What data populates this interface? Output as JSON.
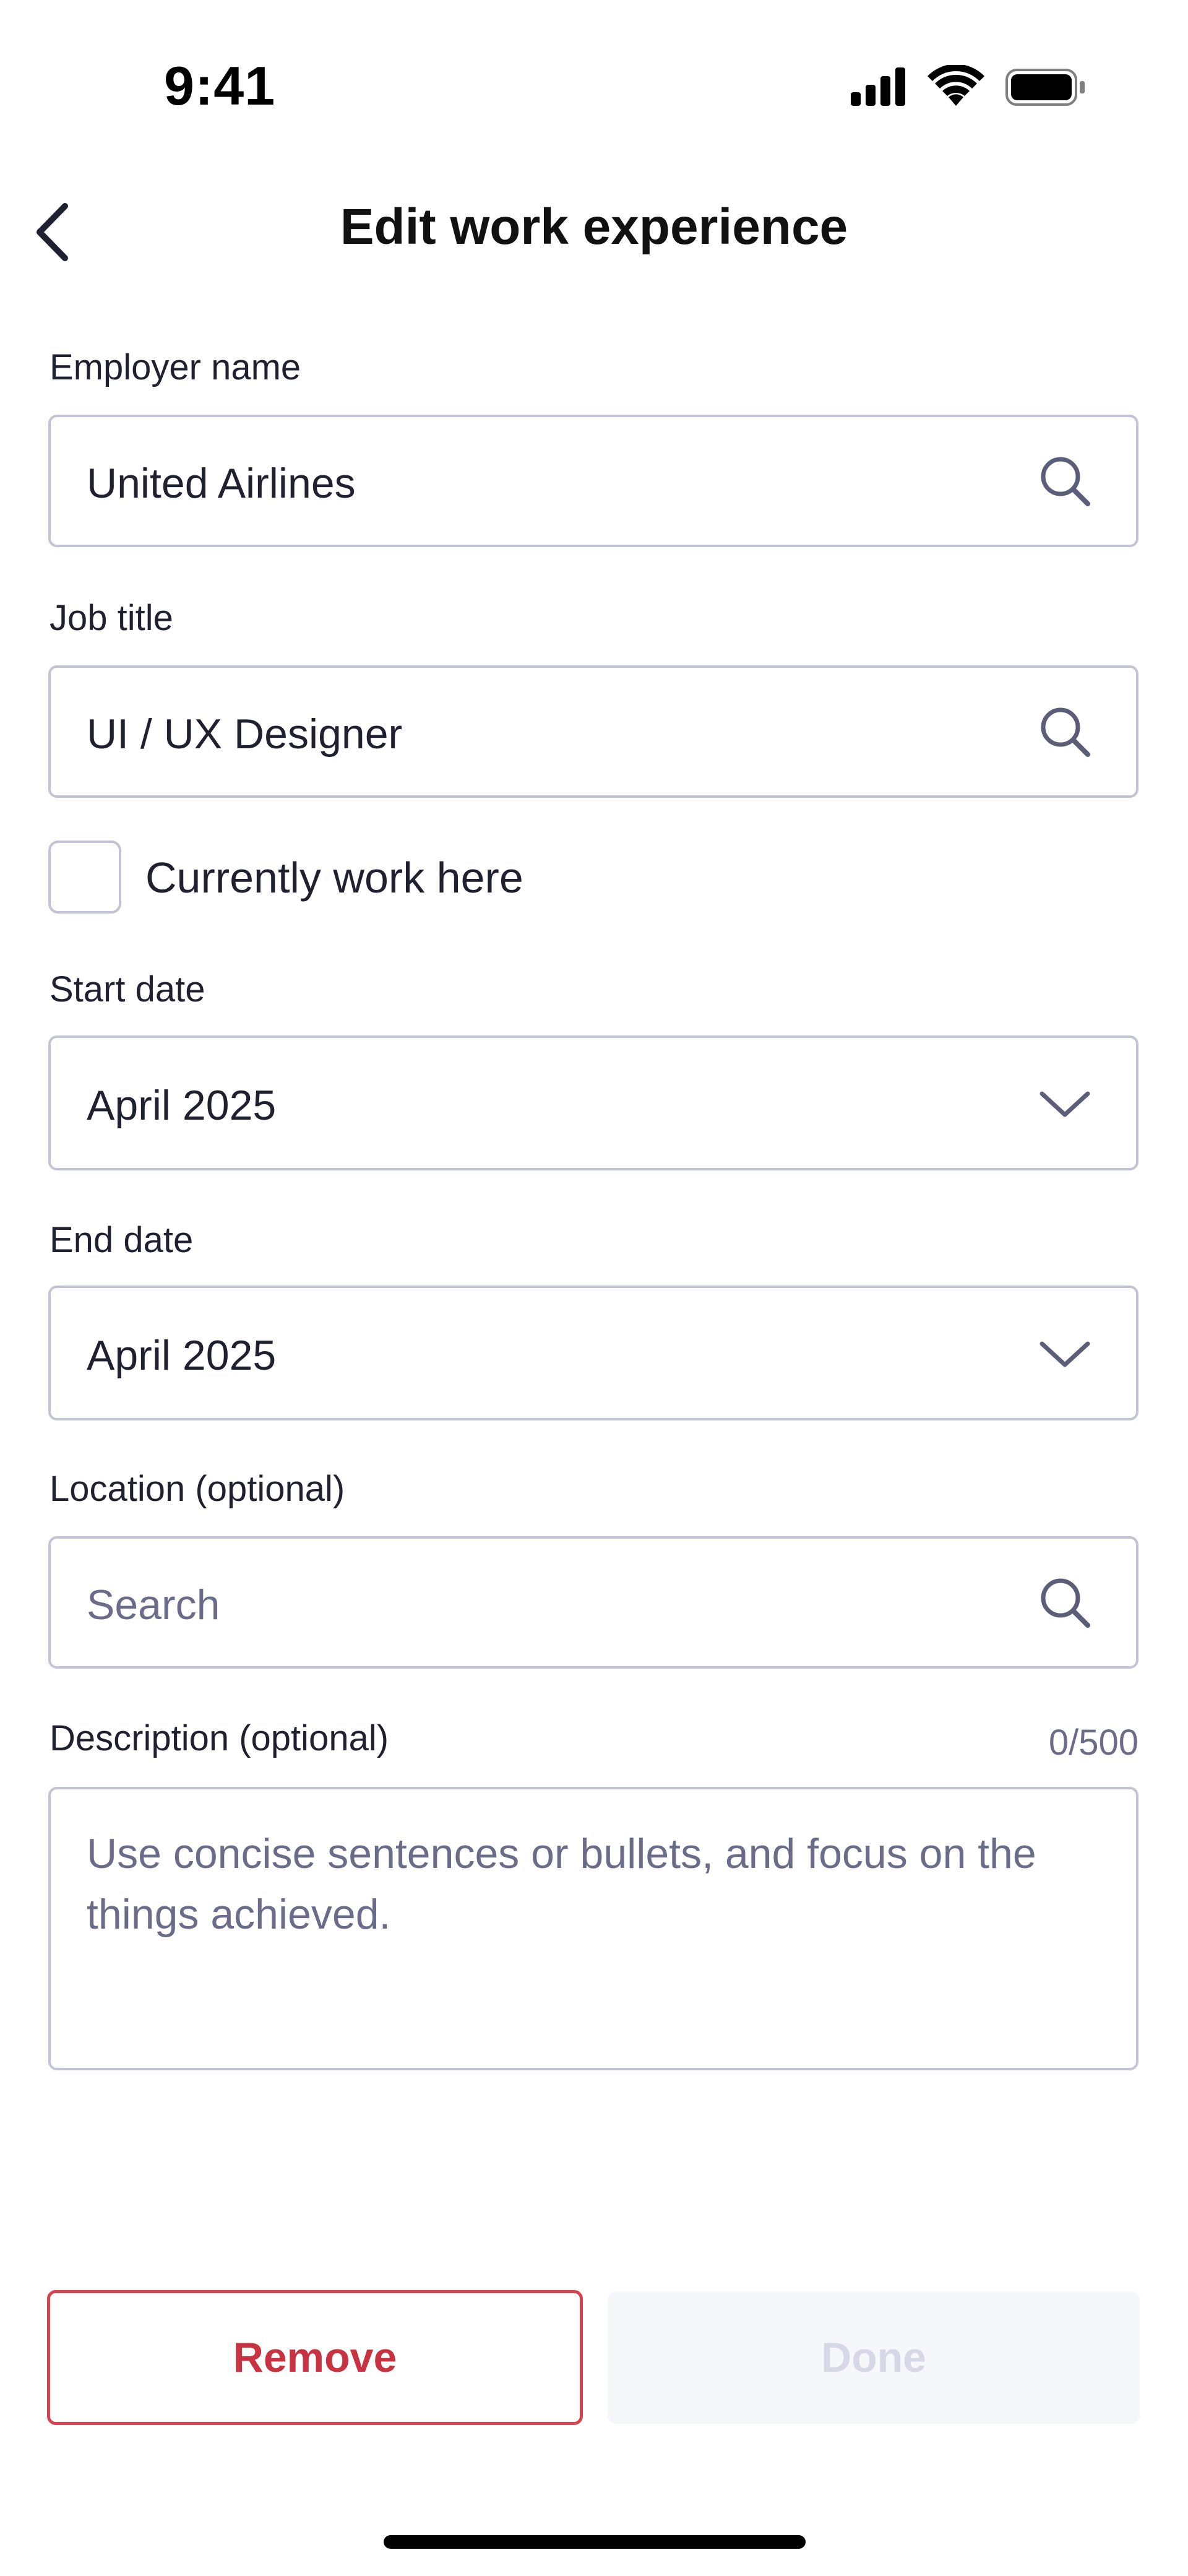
{
  "status_bar": {
    "time": "9:41",
    "icons": [
      "cellular-signal-icon",
      "wifi-icon",
      "battery-icon"
    ]
  },
  "nav": {
    "back_icon": "chevron-left-icon",
    "title": "Edit work experience"
  },
  "form": {
    "employer": {
      "label": "Employer name",
      "value": "United Airlines",
      "icon": "search-icon"
    },
    "job_title": {
      "label": "Job title",
      "value": "UI / UX Designer",
      "icon": "search-icon"
    },
    "currently_work_here": {
      "label": "Currently work here",
      "checked": false
    },
    "start_date": {
      "label": "Start date",
      "value": "April 2025",
      "icon": "chevron-down-icon"
    },
    "end_date": {
      "label": "End date",
      "value": "April 2025",
      "icon": "chevron-down-icon"
    },
    "location": {
      "label": "Location (optional)",
      "placeholder": "Search",
      "value": "",
      "icon": "search-icon"
    },
    "description": {
      "label": "Description (optional)",
      "counter": "0/500",
      "placeholder": "Use concise sentences or bullets, and focus on the things achieved.",
      "value": ""
    }
  },
  "actions": {
    "remove_label": "Remove",
    "done_label": "Done"
  },
  "colors": {
    "border": "#c3c3d6",
    "text": "#1f2030",
    "placeholder": "#6b6c8a",
    "danger": "#c73341",
    "disabled_bg": "#f6f7fb",
    "disabled_text": "#d7d8e6"
  }
}
